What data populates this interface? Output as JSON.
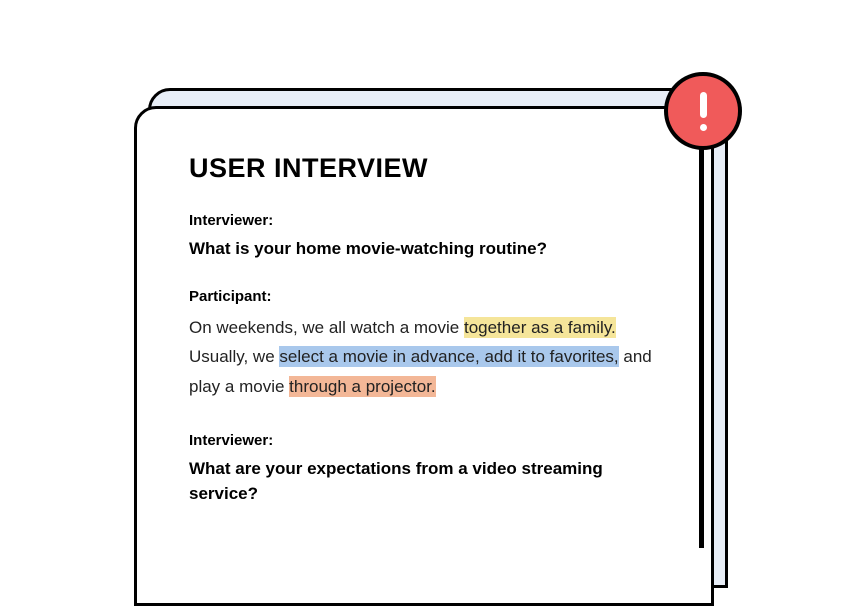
{
  "document": {
    "title": "USER INTERVIEW",
    "blocks": [
      {
        "speaker": "Interviewer:",
        "type": "question",
        "text": "What is your home movie-watching routine?"
      },
      {
        "speaker": "Participant:",
        "type": "answer",
        "segments": [
          {
            "text": "On weekends, we all watch a movie ",
            "highlight": null
          },
          {
            "text": "together as a family.",
            "highlight": "yellow"
          },
          {
            "text": " Usually, we ",
            "highlight": null
          },
          {
            "text": "select a movie in advance, add it to favorites,",
            "highlight": "blue"
          },
          {
            "text": " and play a movie ",
            "highlight": null
          },
          {
            "text": "through a projector.",
            "highlight": "orange"
          }
        ]
      },
      {
        "speaker": "Interviewer:",
        "type": "question",
        "text": "What are your expectations from a video streaming service?"
      }
    ]
  },
  "alert": {
    "icon": "exclamation-icon",
    "color": "#f05a5a"
  },
  "highlight_colors": {
    "yellow": "#f5e59a",
    "blue": "#a9c8ec",
    "orange": "#f3b797"
  }
}
